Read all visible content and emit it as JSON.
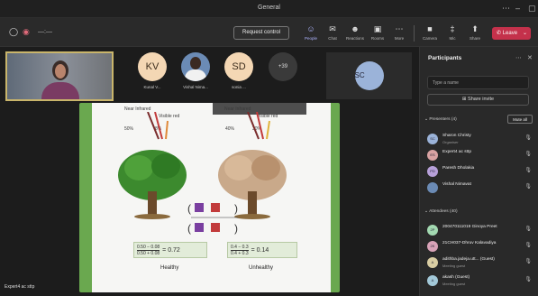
{
  "window": {
    "title": "General"
  },
  "toolbar": {
    "timer": "—:—",
    "request_control": "Request control",
    "tools": [
      {
        "label": "People",
        "icon": "people-icon",
        "glyph": "☺"
      },
      {
        "label": "Chat",
        "icon": "chat-icon",
        "glyph": "✉"
      },
      {
        "label": "Reactions",
        "icon": "reactions-icon",
        "glyph": "☻"
      },
      {
        "label": "Rooms",
        "icon": "rooms-icon",
        "glyph": "▣"
      },
      {
        "label": "More",
        "icon": "more-icon",
        "glyph": "⋯"
      },
      {
        "label": "Camera",
        "icon": "camera-icon",
        "glyph": "■"
      },
      {
        "label": "Mic",
        "icon": "mic-icon",
        "glyph": "‡"
      },
      {
        "label": "Share",
        "icon": "share-icon",
        "glyph": "⬆"
      }
    ],
    "leave_label": "Leave"
  },
  "stage": {
    "tiles": [
      {
        "initials": "KV",
        "name": "Kunal V..."
      },
      {
        "initials": "",
        "name": "Vishal Nima..."
      },
      {
        "initials": "SD",
        "name": "sonia ..."
      },
      {
        "initials": "+39",
        "name": ""
      }
    ],
    "spotlight_initials": "SC",
    "presenter_label": "Expert4 ac sttp"
  },
  "slide": {
    "near_infrared_left": "Near Infrared",
    "visible_red_left": "Visible red",
    "pct_left_nir": "50%",
    "pct_left_red": "8%",
    "near_infrared_right": "Near Infrared",
    "visible_red_right": "Visible red",
    "pct_right_nir": "40%",
    "pct_right_red": "30%",
    "healthy_num": "0.50 − 0.08",
    "healthy_den": "0.50 + 0.08",
    "healthy_result": "= 0.72",
    "unhealthy_num": "0.4 − 0.3",
    "unhealthy_den": "0.4 + 0.3",
    "unhealthy_result": "= 0.14",
    "healthy_label": "Healthy",
    "unhealthy_label": "Unhealthy"
  },
  "panel": {
    "title": "Participants",
    "search_placeholder": "Type a name",
    "share_invite": "Share invite",
    "presenters_header": "Presenters (4)",
    "mute_all": "Mute all",
    "presenters": [
      {
        "initials": "SC",
        "name": "Sharon Christy",
        "role": "Organiser",
        "color": "#9bb3d9"
      },
      {
        "initials": "ES",
        "name": "Expert4 ac sttp",
        "role": "",
        "color": "#d9a3a3"
      },
      {
        "initials": "PD",
        "name": "Paresh Dholakia",
        "role": "",
        "color": "#b7a0d9"
      },
      {
        "initials": "",
        "name": "Vishal Nimavat",
        "role": "",
        "color": "#6b8bb5"
      }
    ],
    "attendees_header": "Attendees (40)",
    "attendees": [
      {
        "initials": "2P",
        "name": "200470111019 Ginoya Preet",
        "role": "",
        "color": "#a3d9b1"
      },
      {
        "initials": "2K",
        "name": "21CH037-Dhruv Kalavadiya",
        "role": "",
        "color": "#d9a3b8"
      },
      {
        "initials": "A",
        "name": "adithba.jadeja.utt... (Guest)",
        "role": "Meeting guest",
        "color": "#d9cda3"
      },
      {
        "initials": "A",
        "name": "akash (Guest)",
        "role": "Meeting guest",
        "color": "#a3c9d9"
      }
    ]
  }
}
